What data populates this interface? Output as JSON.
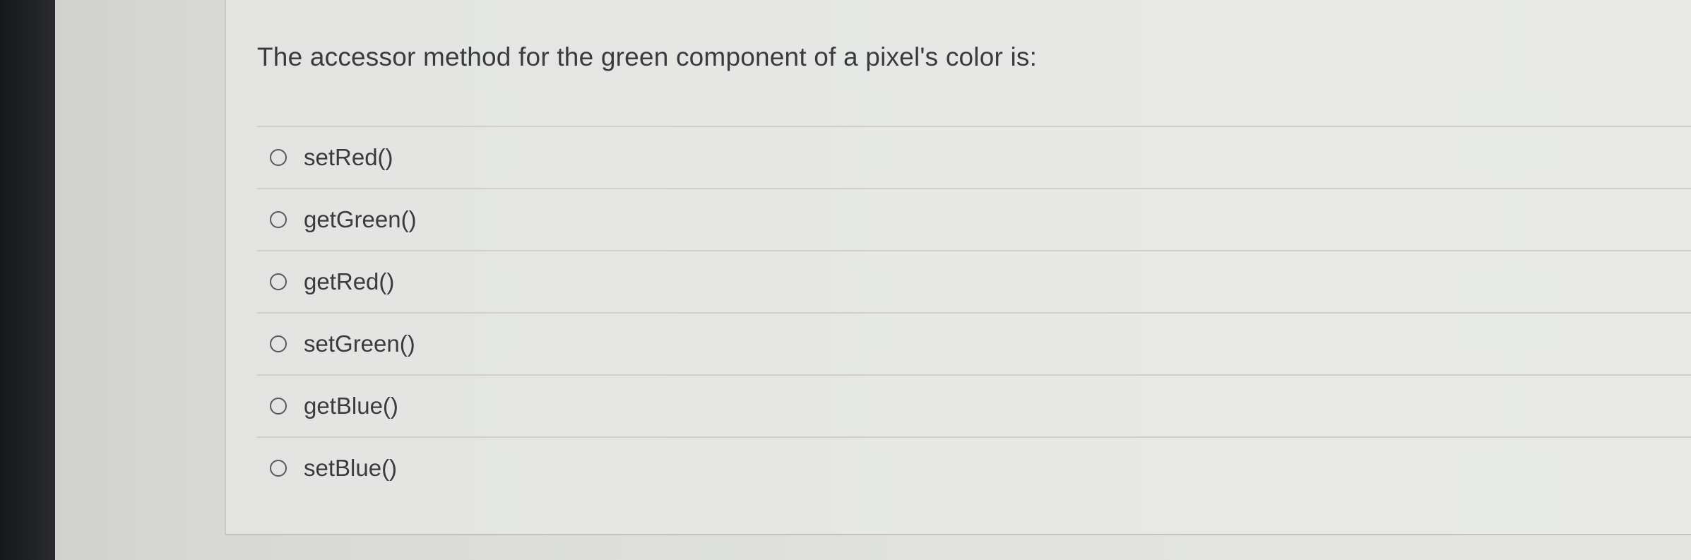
{
  "question": {
    "text": "The accessor method for the green component of a pixel's color is:"
  },
  "options": [
    {
      "label": "setRed()",
      "selected": false
    },
    {
      "label": "getGreen()",
      "selected": false
    },
    {
      "label": "getRed()",
      "selected": false
    },
    {
      "label": "setGreen()",
      "selected": false
    },
    {
      "label": "getBlue()",
      "selected": false
    },
    {
      "label": "setBlue()",
      "selected": false
    }
  ],
  "colors": {
    "text": "#3a3b3d",
    "background": "#e6e7e5",
    "divider": "#cfd0ce",
    "bezel": "#1c1e21"
  }
}
